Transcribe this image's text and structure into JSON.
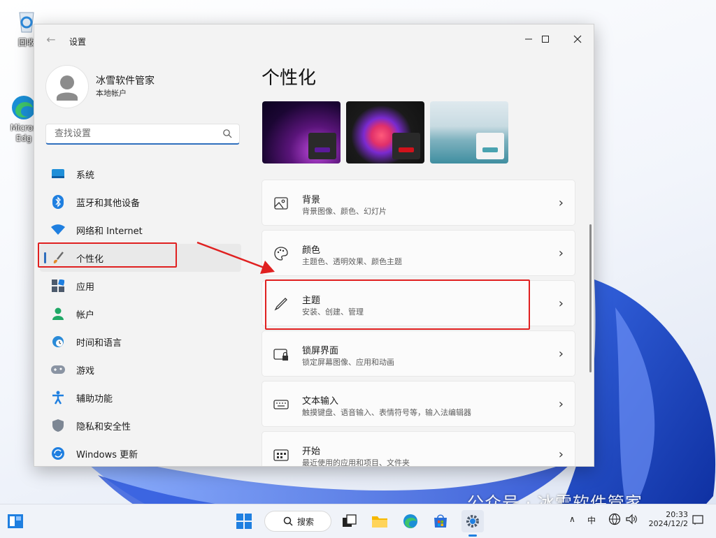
{
  "desktop": {
    "icons": [
      {
        "label": "回收",
        "icon": "recycle-bin-icon"
      },
      {
        "label": "Micros\nEdg",
        "icon": "edge-icon"
      }
    ]
  },
  "window": {
    "title": "设置",
    "user": {
      "name": "冰雪软件管家",
      "account_type": "本地帐户"
    },
    "search_placeholder": "查找设置"
  },
  "sidebar": {
    "items": [
      {
        "label": "系统",
        "icon": "system-icon",
        "active": false
      },
      {
        "label": "蓝牙和其他设备",
        "icon": "bluetooth-icon",
        "active": false
      },
      {
        "label": "网络和 Internet",
        "icon": "wifi-icon",
        "active": false
      },
      {
        "label": "个性化",
        "icon": "brush-icon",
        "active": true
      },
      {
        "label": "应用",
        "icon": "apps-icon",
        "active": false
      },
      {
        "label": "帐户",
        "icon": "account-icon",
        "active": false
      },
      {
        "label": "时间和语言",
        "icon": "globe-clock-icon",
        "active": false
      },
      {
        "label": "游戏",
        "icon": "gamepad-icon",
        "active": false
      },
      {
        "label": "辅助功能",
        "icon": "accessibility-icon",
        "active": false
      },
      {
        "label": "隐私和安全性",
        "icon": "shield-icon",
        "active": false
      },
      {
        "label": "Windows 更新",
        "icon": "update-icon",
        "active": false
      }
    ]
  },
  "main": {
    "title": "个性化",
    "themes": [
      {
        "name": "theme-1",
        "accent": "#5b1a9a"
      },
      {
        "name": "theme-2",
        "accent": "#d0121b"
      },
      {
        "name": "theme-3",
        "accent": "#4aa3b0"
      }
    ],
    "cards": [
      {
        "title": "背景",
        "subtitle": "背景图像、颜色、幻灯片",
        "icon": "image-icon"
      },
      {
        "title": "颜色",
        "subtitle": "主题色、透明效果、颜色主题",
        "icon": "palette-icon"
      },
      {
        "title": "主题",
        "subtitle": "安装、创建、管理",
        "icon": "pen-icon"
      },
      {
        "title": "锁屏界面",
        "subtitle": "锁定屏幕图像、应用和动画",
        "icon": "lock-screen-icon"
      },
      {
        "title": "文本输入",
        "subtitle": "触摸键盘、语音输入、表情符号等，输入法编辑器",
        "icon": "keyboard-icon"
      },
      {
        "title": "开始",
        "subtitle": "最近使用的应用和项目、文件夹",
        "icon": "start-icon"
      }
    ]
  },
  "taskbar": {
    "search_label": "搜索",
    "ime": "中",
    "time": "20:33",
    "date": "2024/12/2",
    "caret": "∧"
  },
  "watermark": "公众号 · 冰雪软件管家",
  "colors": {
    "accent": "#2f6fbd",
    "highlight": "#e02020"
  }
}
